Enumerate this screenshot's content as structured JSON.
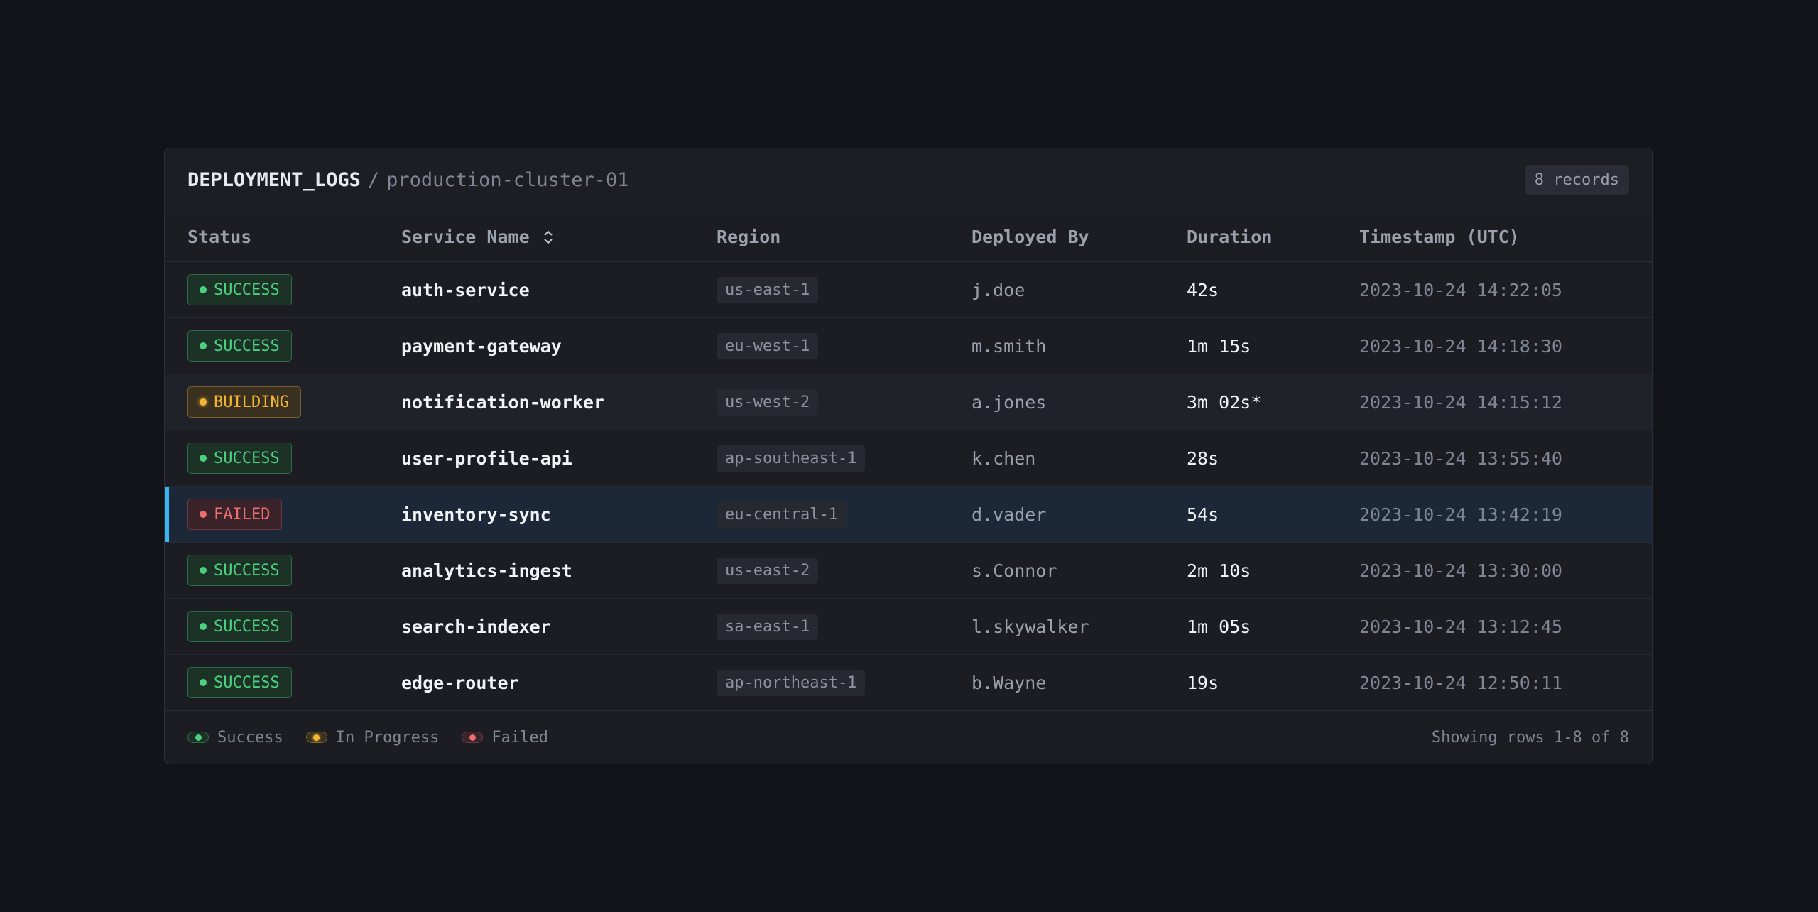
{
  "header": {
    "title": "DEPLOYMENT_LOGS",
    "separator": "/",
    "subtitle": "production-cluster-01",
    "record_count": "8 records"
  },
  "columns": {
    "status": "Status",
    "service": "Service Name",
    "region": "Region",
    "deployed_by": "Deployed By",
    "duration": "Duration",
    "timestamp": "Timestamp (UTC)"
  },
  "rows": [
    {
      "status": "SUCCESS",
      "service": "auth-service",
      "region": "us-east-1",
      "deployed_by": "j.doe",
      "duration": "42s",
      "timestamp": "2023-10-24 14:22:05"
    },
    {
      "status": "SUCCESS",
      "service": "payment-gateway",
      "region": "eu-west-1",
      "deployed_by": "m.smith",
      "duration": "1m 15s",
      "timestamp": "2023-10-24 14:18:30"
    },
    {
      "status": "BUILDING",
      "service": "notification-worker",
      "region": "us-west-2",
      "deployed_by": "a.jones",
      "duration": "3m 02s*",
      "timestamp": "2023-10-24 14:15:12"
    },
    {
      "status": "SUCCESS",
      "service": "user-profile-api",
      "region": "ap-southeast-1",
      "deployed_by": "k.chen",
      "duration": "28s",
      "timestamp": "2023-10-24 13:55:40"
    },
    {
      "status": "FAILED",
      "service": "inventory-sync",
      "region": "eu-central-1",
      "deployed_by": "d.vader",
      "duration": "54s",
      "timestamp": "2023-10-24 13:42:19"
    },
    {
      "status": "SUCCESS",
      "service": "analytics-ingest",
      "region": "us-east-2",
      "deployed_by": "s.Connor",
      "duration": "2m 10s",
      "timestamp": "2023-10-24 13:30:00"
    },
    {
      "status": "SUCCESS",
      "service": "search-indexer",
      "region": "sa-east-1",
      "deployed_by": "l.skywalker",
      "duration": "1m 05s",
      "timestamp": "2023-10-24 13:12:45"
    },
    {
      "status": "SUCCESS",
      "service": "edge-router",
      "region": "ap-northeast-1",
      "deployed_by": "b.Wayne",
      "duration": "19s",
      "timestamp": "2023-10-24 12:50:11"
    }
  ],
  "legend": {
    "success": "Success",
    "in_progress": "In Progress",
    "failed": "Failed"
  },
  "footer": {
    "pagination": "Showing rows 1-8 of 8"
  },
  "colors": {
    "success": "#4ad07e",
    "building": "#f2b532",
    "failed": "#ee6e73",
    "selected_accent": "#38b4f0"
  }
}
